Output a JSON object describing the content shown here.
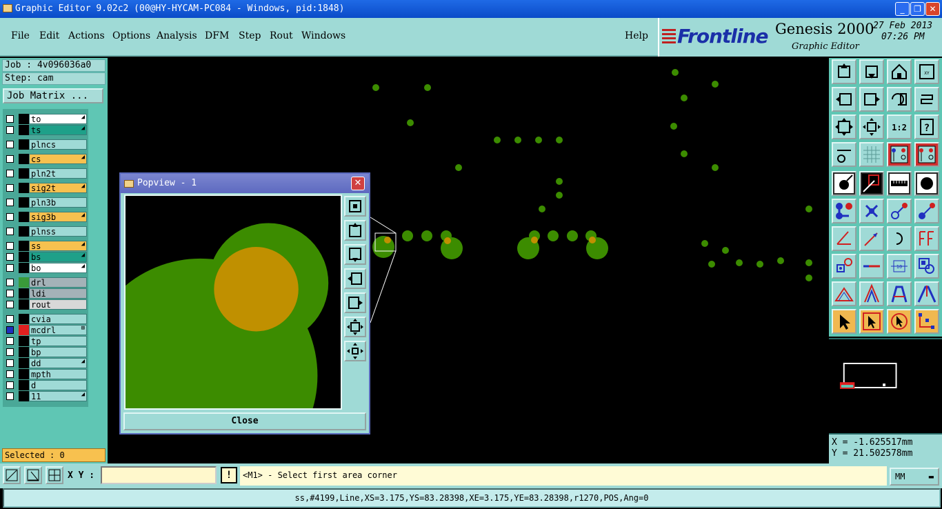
{
  "window": {
    "title": "Graphic Editor 9.02c2 (00@HY-HYCAM-PC084 - Windows, pid:1848)",
    "min_label": "_",
    "max_label": "❐",
    "close_label": "✕"
  },
  "menu": {
    "items": [
      "File",
      "Edit",
      "Actions",
      "Options",
      "Analysis",
      "DFM",
      "Step",
      "Rout",
      "Windows"
    ],
    "help": "Help"
  },
  "brand": {
    "logo": "Frontline",
    "product": "Genesis 2000",
    "subtitle": "Graphic Editor",
    "date": "27 Feb 2013",
    "time": "07:26 PM"
  },
  "job": {
    "job_line": "Job : 4v096036a0",
    "step_line": "Step: cam",
    "matrix_button": "Job Matrix ..."
  },
  "layers": [
    {
      "name": "to",
      "bg": "#ffffff",
      "sq": "#000000",
      "mark": "◢"
    },
    {
      "name": "ts",
      "bg": "#1ea089",
      "sq": "#000000",
      "mark": "◢"
    },
    {
      "name": "plncs",
      "bg": "#9fdad6",
      "sq": "#000000",
      "mark": ""
    },
    {
      "name": "cs",
      "bg": "#f7c14f",
      "sq": "#000000",
      "mark": "◢"
    },
    {
      "name": "pln2t",
      "bg": "#9fdad6",
      "sq": "#000000",
      "mark": ""
    },
    {
      "name": "sig2t",
      "bg": "#f7c14f",
      "sq": "#000000",
      "mark": "◢"
    },
    {
      "name": "pln3b",
      "bg": "#9fdad6",
      "sq": "#000000",
      "mark": ""
    },
    {
      "name": "sig3b",
      "bg": "#f7c14f",
      "sq": "#000000",
      "mark": "◢"
    },
    {
      "name": "plnss",
      "bg": "#9fdad6",
      "sq": "#000000",
      "mark": ""
    },
    {
      "name": "ss",
      "bg": "#f7c14f",
      "sq": "#000000",
      "mark": "◢"
    },
    {
      "name": "bs",
      "bg": "#1ea089",
      "sq": "#000000",
      "mark": "◢"
    },
    {
      "name": "bo",
      "bg": "#ffffff",
      "sq": "#000000",
      "mark": "◢"
    },
    {
      "name": "drl",
      "bg": "#a4b2b8",
      "sq": "#3a9a3a",
      "mark": ""
    },
    {
      "name": "ldi",
      "bg": "#a4b2b8",
      "sq": "#000000",
      "mark": ""
    },
    {
      "name": "rout",
      "bg": "#d8d8d8",
      "sq": "#000000",
      "mark": ""
    },
    {
      "name": "cvia",
      "bg": "#9fdad6",
      "sq": "#000000",
      "mark": ""
    },
    {
      "name": "mcdrl",
      "bg": "#9fdad6",
      "sq": "#e02020",
      "mark": "⊞"
    },
    {
      "name": "tp",
      "bg": "#9fdad6",
      "sq": "#000000",
      "mark": ""
    },
    {
      "name": "bp",
      "bg": "#9fdad6",
      "sq": "#000000",
      "mark": ""
    },
    {
      "name": "dd",
      "bg": "#9fdad6",
      "sq": "#000000",
      "mark": "◢"
    },
    {
      "name": "mpth",
      "bg": "#9fdad6",
      "sq": "#000000",
      "mark": ""
    },
    {
      "name": "d",
      "bg": "#9fdad6",
      "sq": "#000000",
      "mark": ""
    },
    {
      "name": "11",
      "bg": "#9fdad6",
      "sq": "#000000",
      "mark": "◢"
    }
  ],
  "selected": "Selected : 0",
  "popview": {
    "title": "Popview - 1",
    "close_button": "Close"
  },
  "coords": {
    "x": "X = -1.625517mm",
    "y": "Y = 21.502578mm"
  },
  "bottom": {
    "xy_label": "X Y :",
    "xy_value": "",
    "excl": "!",
    "prompt": "<M1> - Select first area corner",
    "units": "MM"
  },
  "status": "ss,#4199,Line,XS=3.175,YS=83.28398,XE=3.175,YE=83.28398,r1270,POS,Ang=0",
  "colors": {
    "pad_green": "#3c8c00",
    "pad_orange": "#c09000",
    "panel": "#9fdad6",
    "layer_panel": "#5fc6b4"
  },
  "icons": {
    "toolbar": [
      "zoom-home-icon",
      "zoom-in-icon",
      "zoom-out-icon",
      "window-icon",
      "pan-left-icon",
      "pan-right-icon",
      "redraw-icon",
      "snap-icon",
      "zoom-fit-icon",
      "zoom-center-icon",
      "scale-icon",
      "help-icon",
      "settings-icon",
      "grid-icon",
      "layer-on-icon",
      "layer-off-icon",
      "fill-icon",
      "outline-icon",
      "measure-icon",
      "pad-icon",
      "connect-icon",
      "cross-icon",
      "line-icon",
      "arrow-icon",
      "angle-icon",
      "slope-icon",
      "arc-icon",
      "text-icon",
      "copy-icon",
      "move-icon",
      "mirror-icon",
      "group-icon",
      "triangle-icon",
      "path-icon",
      "trace-icon",
      "route-icon",
      "select-icon",
      "select-box-icon",
      "rotate-icon",
      "branch-icon"
    ]
  }
}
